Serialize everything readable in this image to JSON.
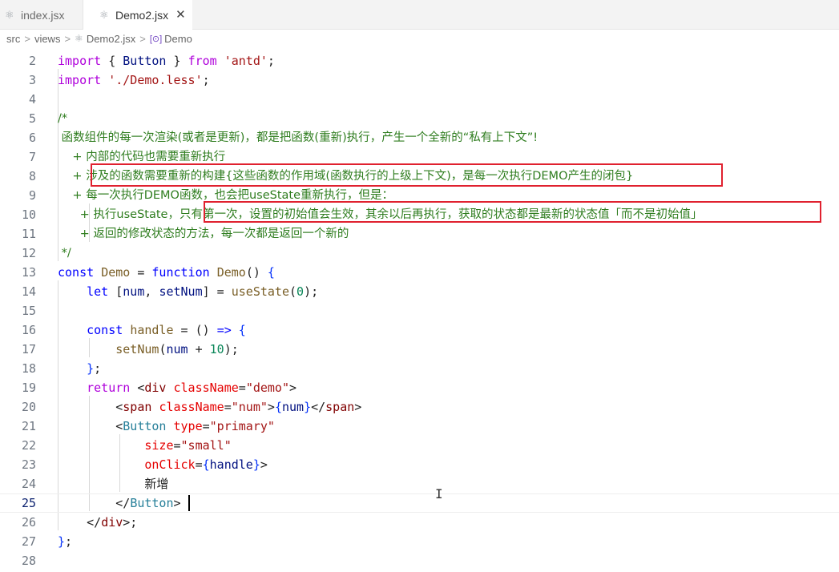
{
  "tabs": [
    {
      "label": "index.jsx",
      "icon": "react-icon",
      "active": false
    },
    {
      "label": "Demo2.jsx",
      "icon": "react-icon",
      "active": true,
      "close": "✕"
    }
  ],
  "breadcrumb": {
    "parts": [
      "src",
      "views",
      "Demo2.jsx",
      "Demo"
    ],
    "separator": ">"
  },
  "editor": {
    "current_line": "25",
    "lines": [
      {
        "n": "2",
        "text": "import { Button } from 'antd';"
      },
      {
        "n": "3",
        "text": "import './Demo.less';"
      },
      {
        "n": "4",
        "text": ""
      },
      {
        "n": "5",
        "text": "/*"
      },
      {
        "n": "6",
        "text": " 函数组件的每一次渲染(或者是更新)，都是把函数(重新)执行，产生一个全新的“私有上下文”!"
      },
      {
        "n": "7",
        "text": "    + 内部的代码也需要重新执行"
      },
      {
        "n": "8",
        "text": "    + 涉及的函数需要重新的构建{这些函数的作用域(函数执行的上级上下文)，是每一次执行DEMO产生的闭包}"
      },
      {
        "n": "9",
        "text": "    + 每一次执行DEMO函数，也会把useState重新执行，但是："
      },
      {
        "n": "10",
        "text": "      + 执行useState，只有第一次，设置的初始值会生效，其余以后再执行，获取的状态都是最新的状态值「而不是初始值」"
      },
      {
        "n": "11",
        "text": "      + 返回的修改状态的方法，每一次都是返回一个新的"
      },
      {
        "n": "12",
        "text": " */"
      },
      {
        "n": "13",
        "text": "const Demo = function Demo() {"
      },
      {
        "n": "14",
        "text": "    let [num, setNum] = useState(0);"
      },
      {
        "n": "15",
        "text": ""
      },
      {
        "n": "16",
        "text": "    const handle = () => {"
      },
      {
        "n": "17",
        "text": "        setNum(num + 10);"
      },
      {
        "n": "18",
        "text": "    };"
      },
      {
        "n": "19",
        "text": "    return <div className=\"demo\">"
      },
      {
        "n": "20",
        "text": "        <span className=\"num\">{num}</span>"
      },
      {
        "n": "21",
        "text": "        <Button type=\"primary\""
      },
      {
        "n": "22",
        "text": "            size=\"small\""
      },
      {
        "n": "23",
        "text": "            onClick={handle}>"
      },
      {
        "n": "24",
        "text": "            新增"
      },
      {
        "n": "25",
        "text": "        </Button>"
      },
      {
        "n": "26",
        "text": "    </div>;"
      },
      {
        "n": "27",
        "text": "};"
      },
      {
        "n": "28",
        "text": ""
      }
    ]
  },
  "colors": {
    "comment": "#2f7d1f",
    "keyword": "#0000ff",
    "control_keyword": "#af00db",
    "string": "#a31515",
    "function": "#795e26",
    "variable": "#001080",
    "highlight_box": "#e0212f"
  }
}
